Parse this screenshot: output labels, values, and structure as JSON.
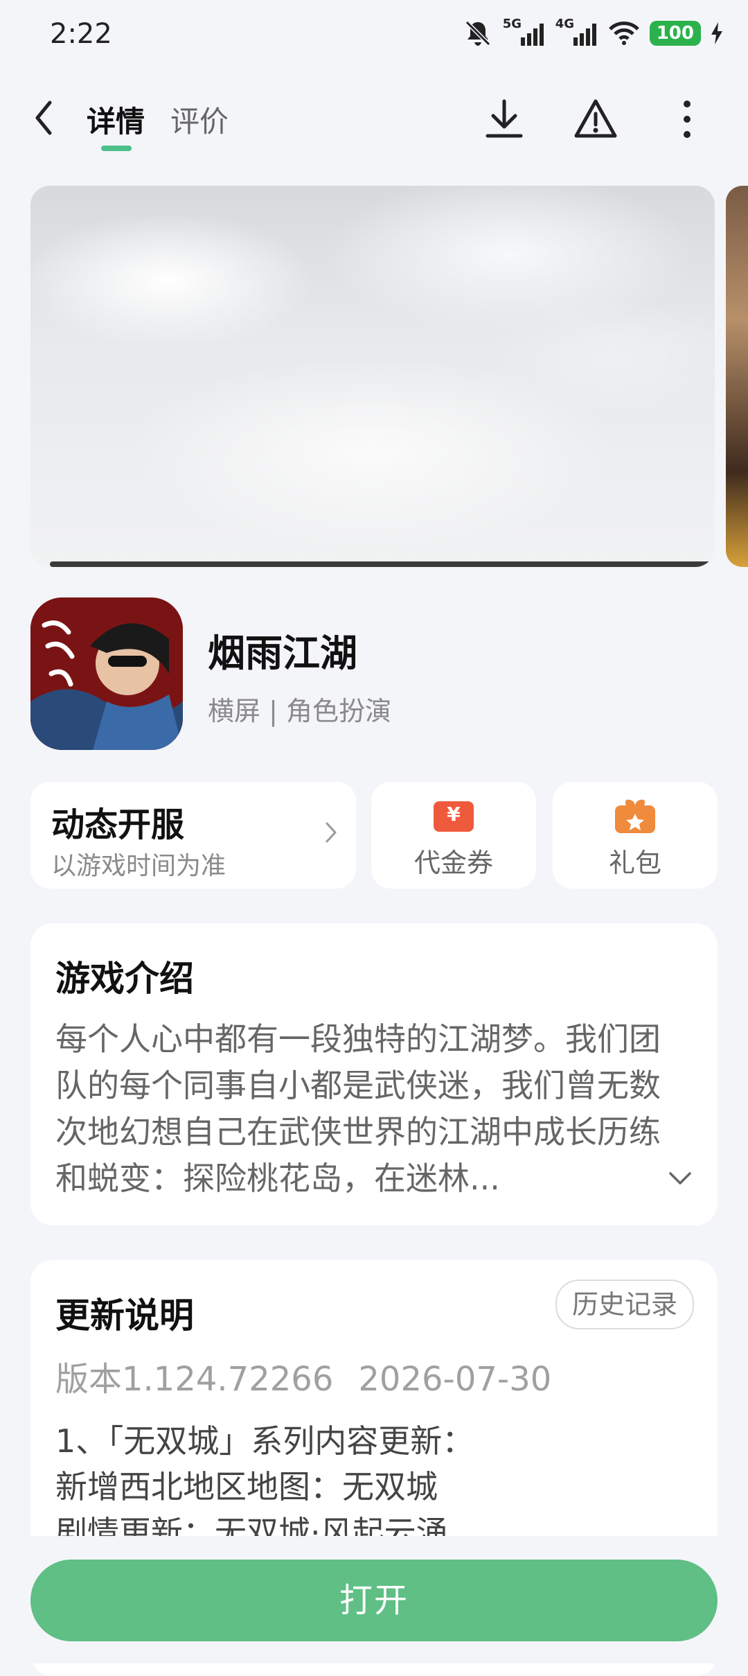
{
  "status": {
    "time": "2:22",
    "network_5g": "5G",
    "network_4g": "4G",
    "battery": "100"
  },
  "nav": {
    "tabs": [
      {
        "label": "详情",
        "active": true
      },
      {
        "label": "评价",
        "active": false
      }
    ]
  },
  "app": {
    "name": "烟雨江湖",
    "tags": "横屏 | 角色扮演"
  },
  "cards": {
    "server_title": "动态开服",
    "server_sub": "以游戏时间为准",
    "voucher_label": "代金券",
    "voucher_icon_glyph": "¥",
    "gift_label": "礼包"
  },
  "intro": {
    "title": "游戏介绍",
    "text": "每个人心中都有一段独特的江湖梦。我们团队的每个同事自小都是武侠迷，我们曾无数次地幻想自己在武侠世界的江湖中成长历练和蜕变：探险桃花岛，在迷林..."
  },
  "update": {
    "title": "更新说明",
    "history_label": "历史记录",
    "version": "版本1.124.72266",
    "date": "2026-07-30",
    "lines": [
      "1、「无双城」系列内容更新：",
      "新增西北地区地图：无双城",
      "剧情更新：无双城·风起云涌"
    ]
  },
  "open_label": "打开",
  "colors": {
    "accent": "#5fbf85",
    "tab_indicator": "#4cc08a",
    "voucher": "#f05a3c",
    "gift": "#f08a3c"
  }
}
